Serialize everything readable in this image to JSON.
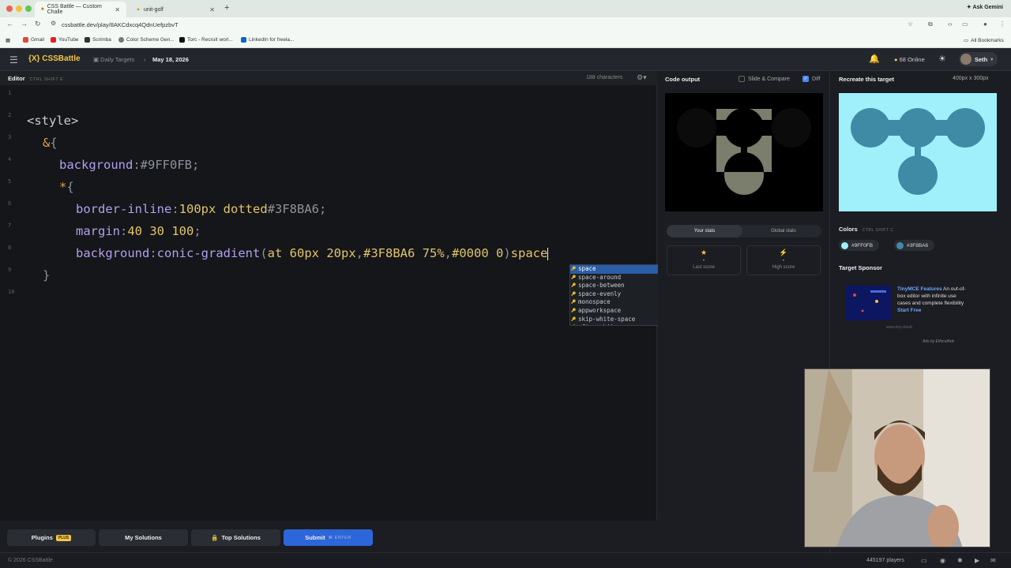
{
  "browser": {
    "tabs": [
      {
        "title": "CSS Battle — Custom Challe",
        "active": true
      },
      {
        "title": "unit-golf",
        "active": false
      }
    ],
    "ask_gemini": "Ask Gemini",
    "url": "cssbattle.dev/play/8AKCdxcq4QdnUefpzbvT",
    "bookmarks": [
      "Gmail",
      "YouTube",
      "Scrimba",
      "Color Scheme Gen...",
      "Torc - Recruit worl...",
      "LinkedIn for freela..."
    ],
    "all_bookmarks": "All Bookmarks"
  },
  "app": {
    "logo": "{X} CSSBattle",
    "breadcrumb_section": "Daily Targets",
    "breadcrumb_date": "May 18, 2026",
    "online_count": "68",
    "online_label": "Online",
    "user_name": "Seth"
  },
  "editor": {
    "title": "Editor",
    "shortcut": "CTRL SHIFT E",
    "char_count": "188 characters",
    "line_numbers": [
      "1",
      "2",
      "3",
      "4",
      "5",
      "6",
      "7",
      "8",
      "9",
      "10"
    ],
    "code": {
      "l2_tag": "<style>",
      "l3_amp": "&",
      "l3_brace": "{",
      "l4_prop": "background",
      "l4_colon": ":",
      "l4_val": "#9FF0FB",
      "l4_semi": ";",
      "l5_star": "*",
      "l5_brace": "{",
      "l6_prop": "border-inline",
      "l6_colon": ":",
      "l6_val1": "100px dotted",
      "l6_val2": "#3F8BA6",
      "l6_semi": ";",
      "l7_prop": "margin",
      "l7_colon": ":",
      "l7_val": "40 30 100",
      "l7_semi": ";",
      "l8_prop": "background",
      "l8_colon": ":",
      "l8_fn": "conic-gradient",
      "l8_open": "(",
      "l8_at": "at 60px 20px",
      "l8_comma1": ",",
      "l8_c1": "#3F8BA6 75%",
      "l8_comma2": ",",
      "l8_c2": "#0000 0",
      "l8_close": ")",
      "l8_typed": "space",
      "l9_brace": "}"
    },
    "autocomplete": [
      "space",
      "space-around",
      "space-between",
      "space-evenly",
      "monospace",
      "appworkspace",
      "skip-white-space",
      "after-white-space"
    ]
  },
  "buttons": {
    "plugins": "Plugins",
    "plus_badge": "PLUS",
    "my_solutions": "My Solutions",
    "top_solutions": "Top Solutions",
    "submit": "Submit",
    "submit_hint": "ENTER"
  },
  "footer": {
    "copyright": "© 2026 CSSBattle",
    "players": "445197",
    "players_label": "players"
  },
  "output": {
    "title": "Code output",
    "slide_compare": "Slide & Compare",
    "diff": "Diff",
    "tabs": [
      "Your stats",
      "Global stats"
    ],
    "last_score_value": "-",
    "last_score_label": "Last score",
    "high_score_value": "-",
    "high_score_label": "High score"
  },
  "target": {
    "title": "Recreate this target",
    "size": "400px x 300px",
    "colors_title": "Colors",
    "colors_shortcut": "CTRL SHIFT C",
    "colors": [
      "#9FF0FB",
      "#3F8BA6"
    ],
    "sponsor_title": "Target Sponsor",
    "ad_title": "TinyMCE Features",
    "ad_body": "An out-of-box editor with infinite use cases and complete flexibility",
    "ad_cta": "Start Free",
    "ad_url": "www.tiny.cloud",
    "ads_by": "Ads by EthicalAds"
  }
}
